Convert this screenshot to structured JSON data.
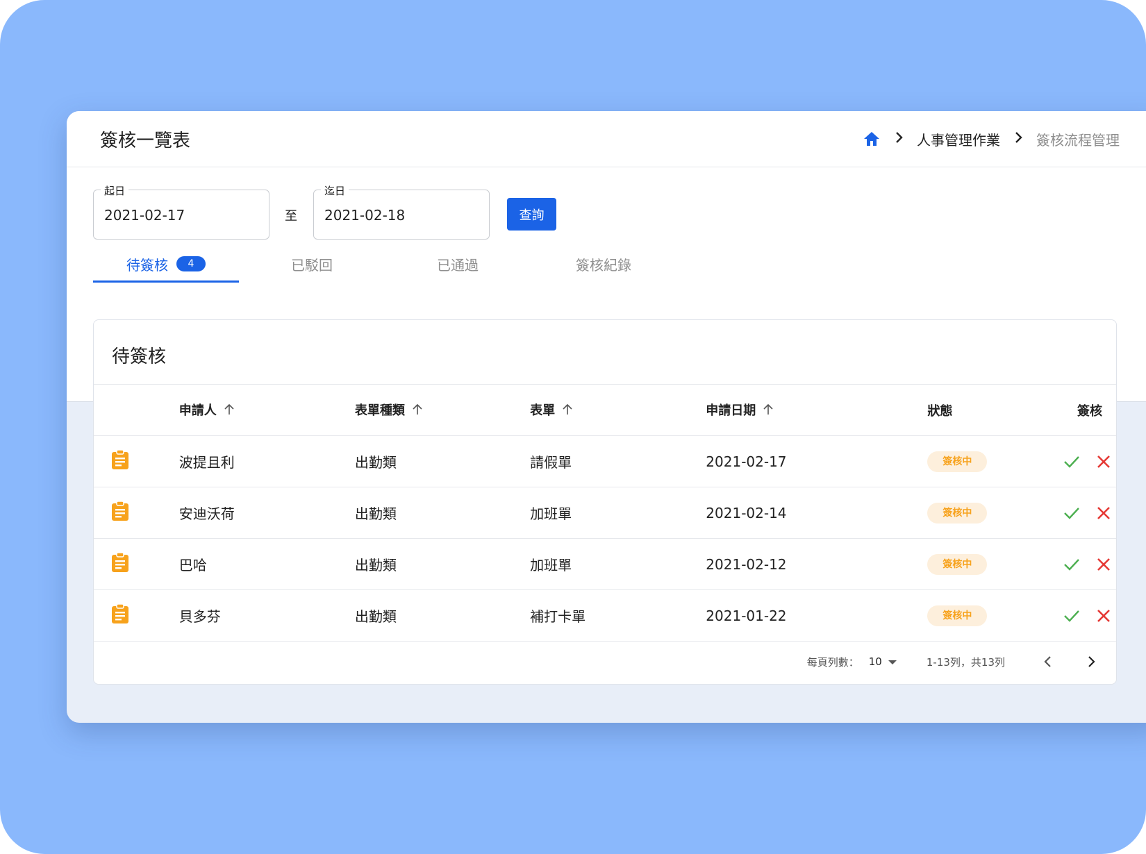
{
  "header": {
    "title": "簽核一覽表",
    "breadcrumb": [
      "人事管理作業",
      "簽核流程管理"
    ]
  },
  "filter": {
    "start_label": "起日",
    "start_value": "2021-02-17",
    "to_label": "至",
    "end_label": "迄日",
    "end_value": "2021-02-18",
    "query_label": "查詢"
  },
  "tabs": [
    {
      "label": "待簽核",
      "badge": "4"
    },
    {
      "label": "已駁回"
    },
    {
      "label": "已通過"
    },
    {
      "label": "簽核紀錄"
    }
  ],
  "card": {
    "title": "待簽核",
    "columns": [
      "申請人",
      "表單種類",
      "表單",
      "申請日期",
      "狀態",
      "簽核"
    ],
    "rows": [
      {
        "applicant": "波提且利",
        "type": "出勤類",
        "form": "請假單",
        "date": "2021-02-17",
        "status": "簽核中"
      },
      {
        "applicant": "安迪沃荷",
        "type": "出勤類",
        "form": "加班單",
        "date": "2021-02-14",
        "status": "簽核中"
      },
      {
        "applicant": "巴哈",
        "type": "出勤類",
        "form": "加班單",
        "date": "2021-02-12",
        "status": "簽核中"
      },
      {
        "applicant": "貝多芬",
        "type": "出勤類",
        "form": "補打卡單",
        "date": "2021-01-22",
        "status": "簽核中"
      }
    ]
  },
  "pagination": {
    "rows_per_page_label": "每頁列數：",
    "rows_per_page": "10",
    "range_text": "1-13列，共13列"
  },
  "colors": {
    "primary": "#1b63e6",
    "background": "#8ab8fc",
    "status_pending_bg": "#fdefdc",
    "status_pending_text": "#f7a21c",
    "approve": "#4caf50",
    "reject": "#e53935"
  },
  "icons": [
    "home-icon",
    "chevron-right-icon",
    "arrow-up-icon",
    "clipboard-icon",
    "check-icon",
    "close-icon",
    "caret-down-icon",
    "chevron-left-icon"
  ]
}
